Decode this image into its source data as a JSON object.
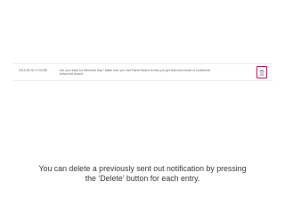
{
  "notification": {
    "timestamp": "2013-05-30 17:00:58",
    "message": "Are you ready for Memorial Day? Make sure you visit Planet Beach to help you get that extra boost of confidence before the beach!",
    "delete_icon": "trash-icon",
    "delete_accent_color": "#c2185b"
  },
  "caption": {
    "line1": "You can delete a previously sent out notification by pressing",
    "line2": "the ‘Delete’ button for each entry."
  }
}
